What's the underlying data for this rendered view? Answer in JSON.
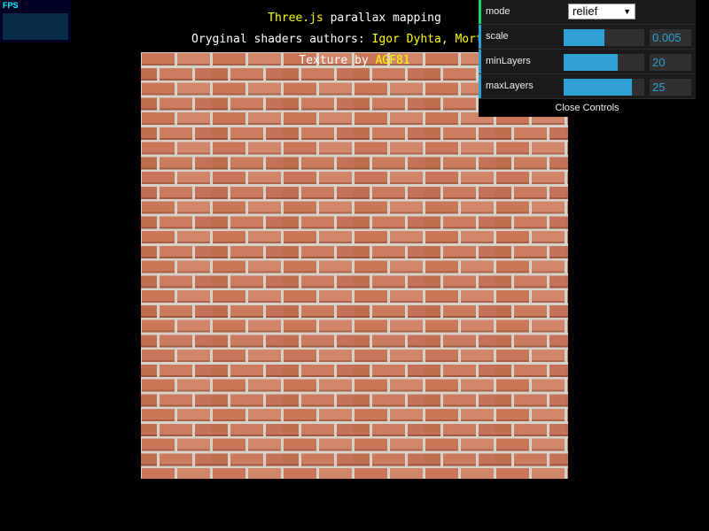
{
  "stats": {
    "label": "FPS"
  },
  "info": {
    "line1": {
      "link": "Three.js",
      "text": " parallax mapping"
    },
    "line2": {
      "prefix": "Oryginal shaders authors: ",
      "author1": "Igor Dyhta",
      "sep": ", ",
      "author2": "Morten S."
    },
    "line3": {
      "prefix": "Texture by ",
      "author": "AGF81"
    }
  },
  "gui": {
    "mode": {
      "label": "mode",
      "value": "relief"
    },
    "scale": {
      "label": "scale",
      "value": "0.005",
      "fill_fraction": 0.5
    },
    "minLayers": {
      "label": "minLayers",
      "value": "20",
      "fill_fraction": 0.67
    },
    "maxLayers": {
      "label": "maxLayers",
      "value": "25",
      "fill_fraction": 0.85
    },
    "close_label": "Close Controls"
  },
  "colors": {
    "accent": "#2fa1d6",
    "mode_stripe": "#1ed36f",
    "number_stripe": "#2fa1d6",
    "link": "#ffff00"
  }
}
